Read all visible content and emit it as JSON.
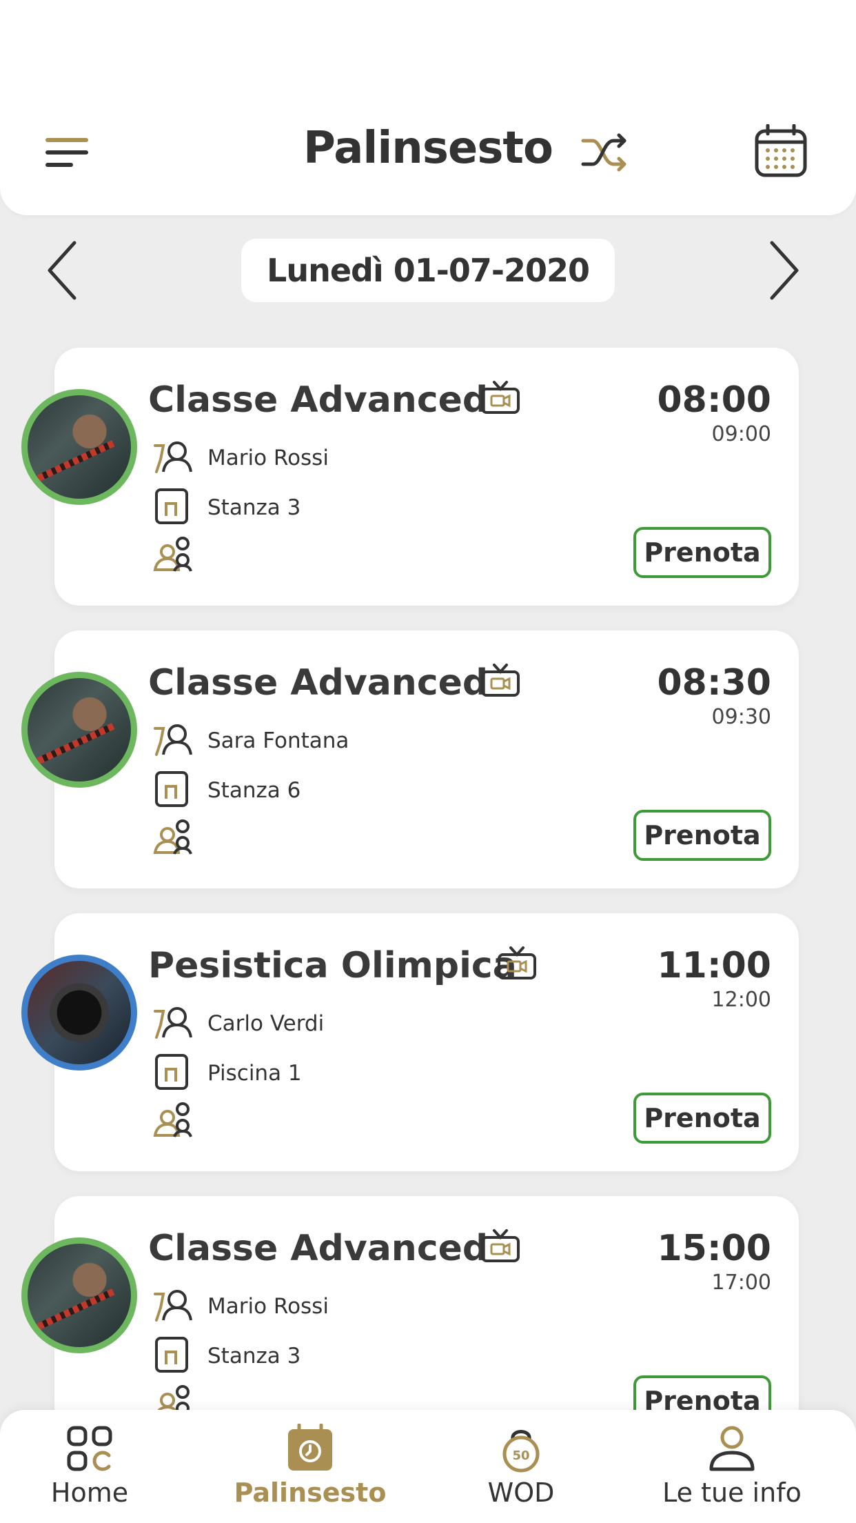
{
  "header": {
    "title": "Palinsesto",
    "menu_icon": "hamburger-menu-icon",
    "shuffle_icon": "shuffle-icon",
    "calendar_icon": "calendar-icon"
  },
  "date_nav": {
    "date": "Lunedì 01-07-2020"
  },
  "classes": [
    {
      "title": "Classe Advanced",
      "start": "08:00",
      "end": "09:00",
      "trainer": "Mario Rossi",
      "room": "Stanza 3",
      "book_label": "Prenota",
      "ring_color": "#6db85f"
    },
    {
      "title": "Classe Advanced",
      "start": "08:30",
      "end": "09:30",
      "trainer": "Sara Fontana",
      "room": "Stanza 6",
      "book_label": "Prenota",
      "ring_color": "#6db85f"
    },
    {
      "title": "Pesistica Olimpica",
      "start": "11:00",
      "end": "12:00",
      "trainer": "Carlo Verdi",
      "room": "Piscina 1",
      "book_label": "Prenota",
      "ring_color": "#3f7fc9"
    },
    {
      "title": "Classe Advanced",
      "start": "15:00",
      "end": "17:00",
      "trainer": "Mario Rossi",
      "room": "Stanza 3",
      "book_label": "Prenota",
      "ring_color": "#6db85f"
    }
  ],
  "bottom_nav": {
    "items": [
      {
        "label": "Home",
        "icon": "grid-icon"
      },
      {
        "label": "Palinsesto",
        "icon": "schedule-icon",
        "active": true
      },
      {
        "label": "WOD",
        "icon": "kettlebell-icon",
        "icon_text": "50"
      },
      {
        "label": "Le tue info",
        "icon": "user-icon"
      }
    ]
  },
  "colors": {
    "accent_gold": "#a98f52",
    "book_green": "#3d9a37",
    "text_dark": "#333333",
    "background": "#ededed"
  }
}
